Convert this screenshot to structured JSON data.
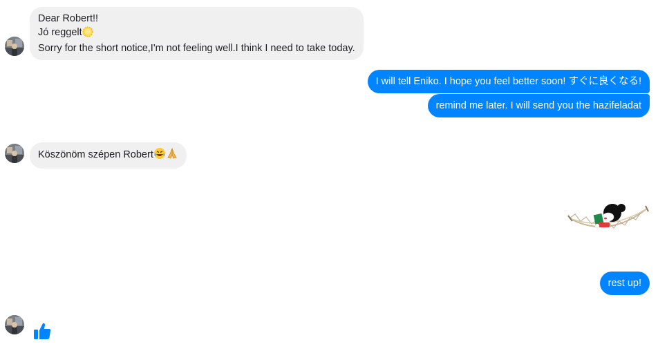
{
  "conversation": {
    "incoming_1": {
      "line_1": "Dear Robert!!",
      "line_2": "Jó reggelt",
      "line_2_emoji": "sun-emoji",
      "line_3": "Sorry for the short notice,I'm not feeling well.I think I need to take today."
    },
    "outgoing_1": "I will tell Eniko. I hope you feel better soon! すぐに良くなる!",
    "outgoing_2": "remind me later.  I will send you the hazifeladat",
    "incoming_2": {
      "text": "Köszönöm szépen Robert",
      "emojis": [
        "laughing-tears-emoji",
        "folded-hands-emoji"
      ]
    },
    "sticker": "hammock-reading-sticker",
    "outgoing_3": "rest up!",
    "incoming_reaction": "thumbs-up-icon"
  },
  "colors": {
    "incoming_bubble": "#f0f0f0",
    "outgoing_bubble": "#0084ff",
    "like": "#0084ff"
  }
}
